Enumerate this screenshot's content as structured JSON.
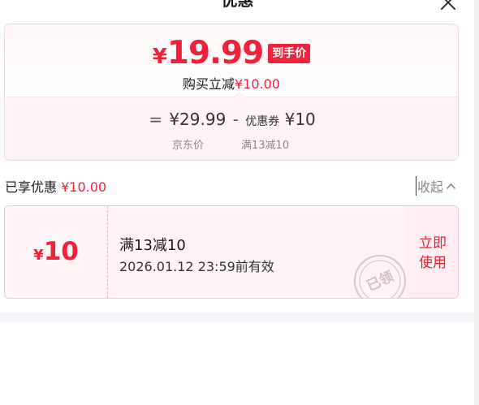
{
  "header": {
    "title": "优惠"
  },
  "price_card": {
    "yen_symbol": "¥",
    "final_price": "19.99",
    "final_badge": "到手价",
    "save_prefix": "购买立减",
    "save_amount": "¥10.00",
    "equals": "=",
    "original_price": "¥29.99",
    "minus": "-",
    "coupon_prefix": "优惠券",
    "coupon_amount": "¥10",
    "jd_price_label": "京东价",
    "coupon_rule_label": "满13减10"
  },
  "savings": {
    "label": "已享优惠",
    "amount": "¥10.00",
    "collapse_label": "收起"
  },
  "coupon": {
    "yen_symbol": "¥",
    "value": "10",
    "title": "满13减10",
    "expiry": "2026.01.12 23:59前有效",
    "stamp_text": "已领",
    "use_label_line1": "立即",
    "use_label_line2": "使用"
  },
  "colors": {
    "accent": "#f0213b",
    "coupon_bg": "#fff5f7",
    "stamp": "#d8c9cc"
  },
  "icons": {
    "close": "close-icon",
    "collapse": "chevron-up-icon",
    "stamp": "claimed-stamp-icon"
  }
}
